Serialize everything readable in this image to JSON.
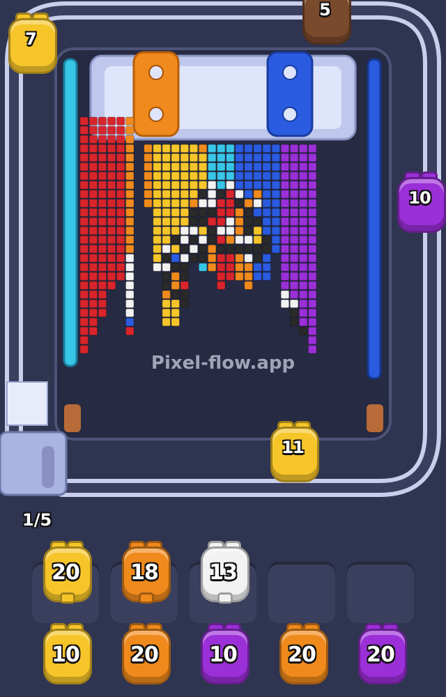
{
  "colors": {
    "background": "#2f3450",
    "track": "#c9ceea",
    "red": "#d8252b",
    "orange": "#f08a1c",
    "yellow": "#f6c52a",
    "cyan": "#38c6e8",
    "blue": "#2a5be0",
    "purple": "#9b2fd8",
    "black": "#2a2a2a",
    "white": "#f2f2f2",
    "brown": "#7a4a2c"
  },
  "watermark": "Pixel-flow.app",
  "track_text": "Pixel-Flow.app",
  "progress": "1/5",
  "track_pigs": [
    {
      "count": "7",
      "color": "yellow"
    },
    {
      "count": "5",
      "color": "brown"
    },
    {
      "count": "10",
      "color": "purple"
    },
    {
      "count": "11",
      "color": "yellow"
    }
  ],
  "holding_slots": [
    {
      "count": "20",
      "color": "yellow"
    },
    {
      "count": "18",
      "color": "orange"
    },
    {
      "count": "13",
      "color": "white"
    },
    {
      "empty": true
    },
    {
      "empty": true
    }
  ],
  "queue_pigs": [
    {
      "count": "10",
      "color": "yellow"
    },
    {
      "count": "20",
      "color": "orange"
    },
    {
      "count": "10",
      "color": "purple"
    },
    {
      "count": "20",
      "color": "orange"
    },
    {
      "count": "20",
      "color": "purple"
    }
  ],
  "pixel_columns": [
    {
      "cells": "RRRRRRRRRRRRRRRRRRRRRRRRRR"
    },
    {
      "cells": "RRRRRRRRRRRRRRRRRRRRRRRR"
    },
    {
      "cells": "RRRRRRRRRRRRRRRRRRRRRR"
    },
    {
      "cells": "RRRRRRRRRRRRRRRRRRR"
    },
    {
      "cells": "RRRRRRRRRRRRRRRRRR"
    },
    {
      "cells": "OOOOOOOOOOOOOOOWWWWWWWBR"
    },
    {
      "cells": ""
    },
    {
      "cells": "OOOOOOO"
    },
    {
      "cells": "YYYYYYYYYYYYYW"
    },
    {
      "cells": "YYYYYYYYYYYWKWKKOYYY"
    },
    {
      "cells": "YYYYYYYYYYKYBKOOKYYY"
    },
    {
      "cells": "YYYYYYYYYWWKWKKRKK"
    },
    {
      "cells": "YYYYYYOKKWKWK"
    },
    {
      "cells": "OYYYYKWKKYWKKC"
    },
    {
      "cells": "CCCCWWWKRKKOOO"
    },
    {
      "cells": "CCCCCKRRRWRKRRRR"
    },
    {
      "cells": "CCCCWRRRWWOKRRR"
    },
    {
      "cells": "BBBBBWKOOOWKOOO"
    },
    {
      "cells": "BBBBBBOKKKWKWOOO"
    },
    {
      "cells": "BBBBBOWBKYYKKBB"
    },
    {
      "cells": "BBBBBBBBBBKKBBB"
    },
    {
      "cells": "BBBBBBBBBBBB"
    },
    {
      "cells": "PPPPPPPPPPPPPPPPWW"
    },
    {
      "cells": "PPPPPPPPPPPPPPPPPWKK"
    },
    {
      "cells": "PPPPPPPPPPPPPPPPPPPPK"
    },
    {
      "cells": "PPPPPPPPPPPPPPPPPPPPPPP"
    }
  ]
}
